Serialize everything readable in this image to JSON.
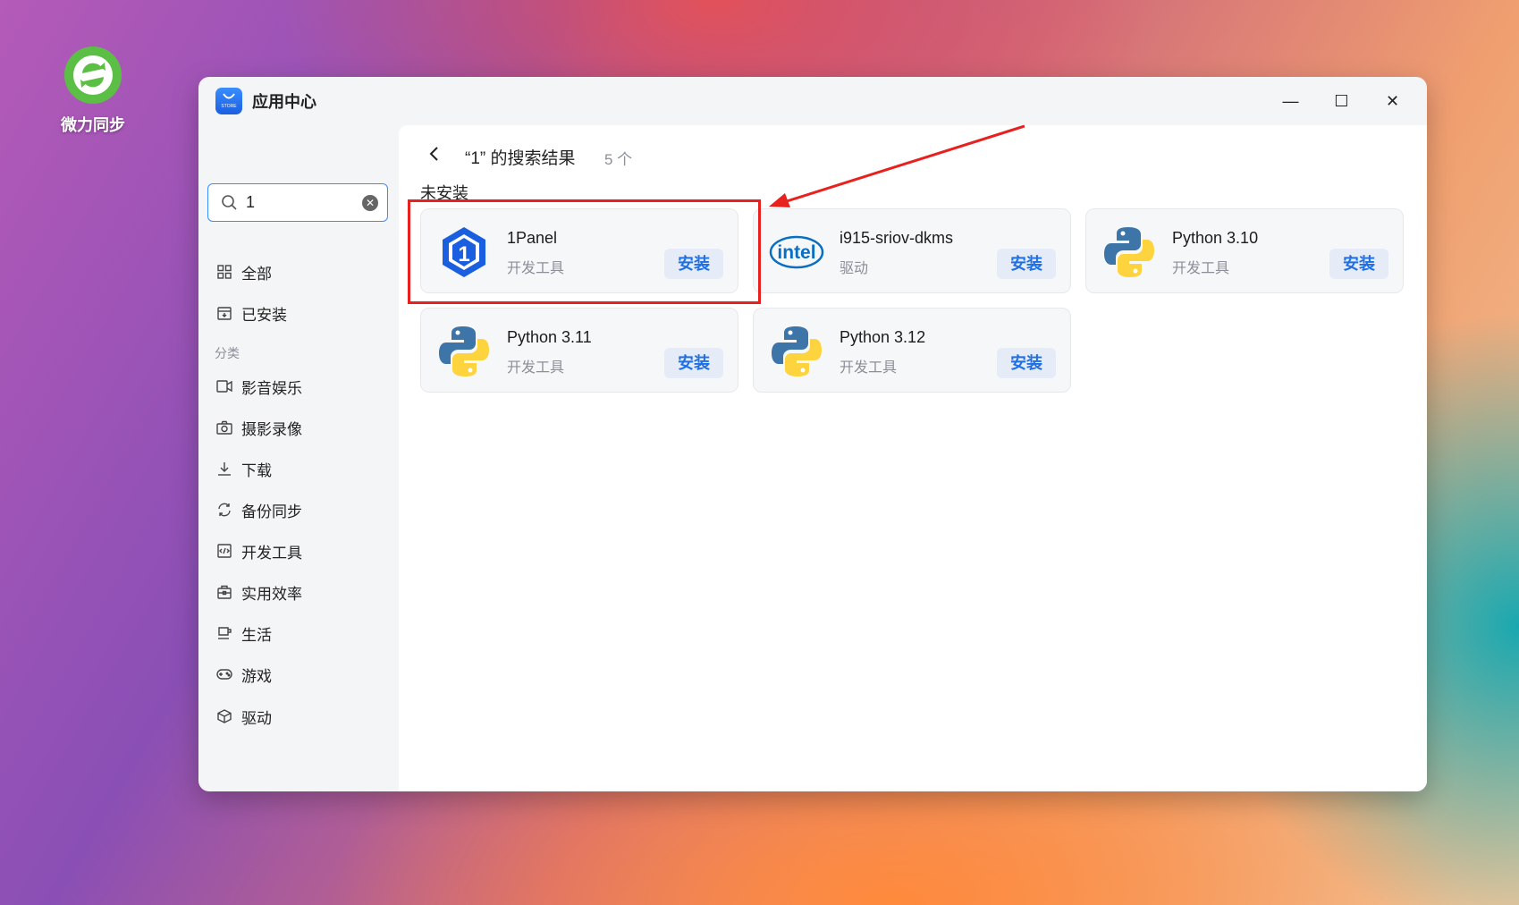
{
  "desktop": {
    "icon_label": "微力同步"
  },
  "window": {
    "title": "应用中心",
    "logo_text": "STORE",
    "controls": {
      "minimize": "—",
      "maximize": "☐",
      "close": "✕"
    }
  },
  "sidebar": {
    "search": {
      "value": "1",
      "placeholder": ""
    },
    "top_items": [
      {
        "label": "全部",
        "icon": "grid-icon"
      },
      {
        "label": "已安装",
        "icon": "installed-icon"
      }
    ],
    "section_label": "分类",
    "categories": [
      {
        "label": "影音娱乐",
        "icon": "video-icon"
      },
      {
        "label": "摄影录像",
        "icon": "camera-icon"
      },
      {
        "label": "下载",
        "icon": "download-icon"
      },
      {
        "label": "备份同步",
        "icon": "sync-icon"
      },
      {
        "label": "开发工具",
        "icon": "code-icon"
      },
      {
        "label": "实用效率",
        "icon": "toolbox-icon"
      },
      {
        "label": "生活",
        "icon": "cup-icon"
      },
      {
        "label": "游戏",
        "icon": "gamepad-icon"
      },
      {
        "label": "驱动",
        "icon": "box-icon"
      }
    ]
  },
  "main": {
    "results_title": "“1” 的搜索结果",
    "results_count": "5 个",
    "group_label": "未安装",
    "apps": [
      {
        "name": "1Panel",
        "category": "开发工具",
        "button": "安装",
        "icon": "1panel-logo-icon"
      },
      {
        "name": "i915-sriov-dkms",
        "category": "驱动",
        "button": "安装",
        "icon": "intel-logo-icon"
      },
      {
        "name": "Python 3.10",
        "category": "开发工具",
        "button": "安装",
        "icon": "python-logo-icon"
      },
      {
        "name": "Python 3.11",
        "category": "开发工具",
        "button": "安装",
        "icon": "python-logo-icon"
      },
      {
        "name": "Python 3.12",
        "category": "开发工具",
        "button": "安装",
        "icon": "python-logo-icon"
      }
    ]
  },
  "colors": {
    "accent": "#1f6fe5",
    "highlight": "#e8201e"
  }
}
